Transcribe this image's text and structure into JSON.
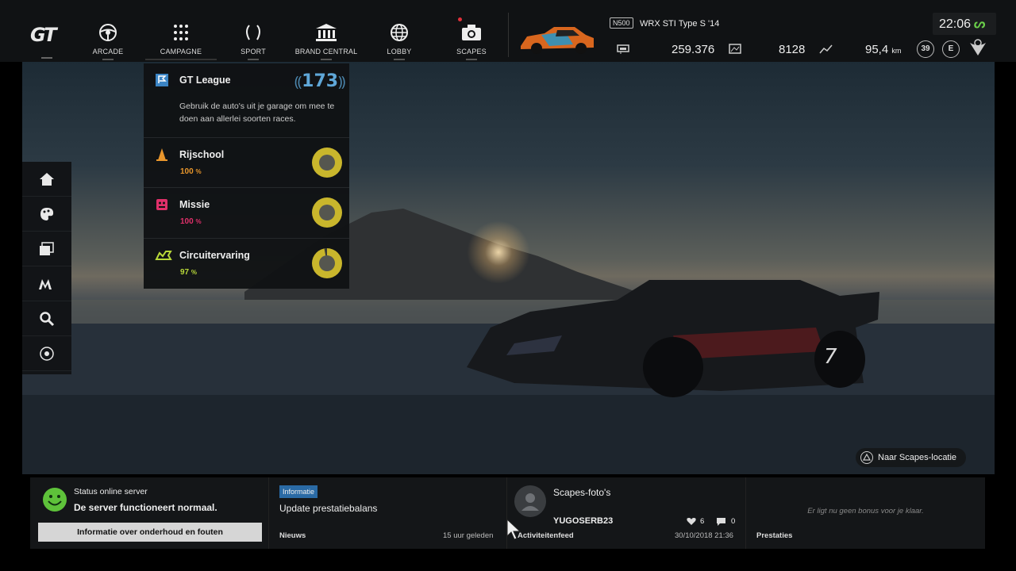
{
  "topbar": {
    "nav": [
      {
        "label": "ARCADE",
        "icon": "steering-wheel-icon"
      },
      {
        "label": "CAMPAGNE",
        "icon": "grid-dots-icon"
      },
      {
        "label": "SPORT",
        "icon": "laurel-icon"
      },
      {
        "label": "BRAND CENTRAL",
        "icon": "building-icon"
      },
      {
        "label": "LOBBY",
        "icon": "globe-icon"
      },
      {
        "label": "SCAPES",
        "icon": "camera-icon"
      }
    ],
    "car": {
      "badge": "N500",
      "name": "WRX STI Type S '14"
    },
    "credits": "259.376",
    "mileage_points": "8128",
    "distance": "95,4",
    "distance_unit": "km",
    "level": "39",
    "rating": "E",
    "clock": "22:06"
  },
  "sidebar": {
    "items": [
      "home-icon",
      "paint-palette-icon",
      "gallery-icon",
      "brand-m-icon",
      "search-icon",
      "target-icon"
    ]
  },
  "campaign_menu": {
    "league": {
      "title": "GT League",
      "count": "173",
      "description": "Gebruik de auto's uit je garage om mee te doen aan allerlei soorten races."
    },
    "items": [
      {
        "title": "Rijschool",
        "percent": "100",
        "unit": "%",
        "color": "#e8962c",
        "progress": 1.0
      },
      {
        "title": "Missie",
        "percent": "100",
        "unit": "%",
        "color": "#e0306a",
        "progress": 1.0
      },
      {
        "title": "Circuitervaring",
        "percent": "97",
        "unit": "%",
        "color": "#b8d839",
        "progress": 0.97
      }
    ]
  },
  "scapes_link": "Naar Scapes-locatie",
  "bottom": {
    "server": {
      "title": "Status online server",
      "message": "De server functioneert normaal.",
      "button": "Informatie over onderhoud en fouten"
    },
    "news": {
      "tag": "Informatie",
      "headline": "Update prestatiebalans",
      "section": "Nieuws",
      "time": "15 uur geleden"
    },
    "feed": {
      "title": "Scapes-foto's",
      "user": "YUGOSERB23",
      "likes": "6",
      "comments": "0",
      "section": "Activiteitenfeed",
      "date": "30/10/2018 21:36"
    },
    "bonus": {
      "message": "Er ligt nu geen bonus voor je klaar.",
      "section": "Prestaties"
    }
  }
}
